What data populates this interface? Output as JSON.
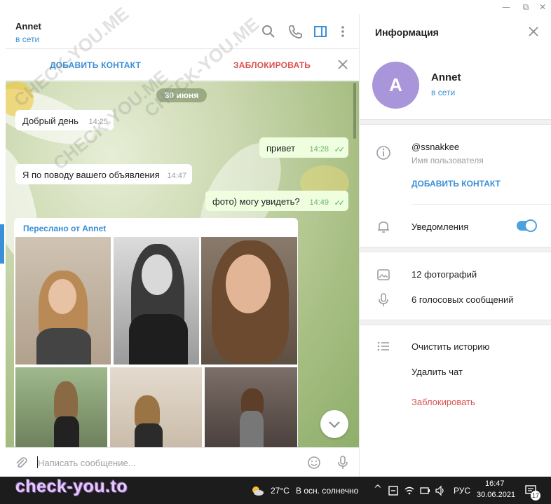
{
  "window": {
    "minimize": "—",
    "maximize": "⧉",
    "close": "✕"
  },
  "chat_header": {
    "name": "Annet",
    "status": "в сети",
    "icons": [
      "search-icon",
      "phone-icon",
      "sidebar-toggle-icon",
      "more-vertical-icon"
    ]
  },
  "action_bar": {
    "add_contact": "ДОБАВИТЬ КОНТАКТ",
    "block": "ЗАБЛОКИРОВАТЬ",
    "close_icon": "close-icon"
  },
  "messages": {
    "date": "30 июня",
    "m1": {
      "text": "Добрый день",
      "time": "14:25",
      "direction": "in"
    },
    "m2": {
      "text": "привет",
      "time": "14:28",
      "direction": "out",
      "ticks": "✓✓"
    },
    "m3": {
      "text": "Я по поводу вашего объявления",
      "time": "14:47",
      "direction": "in"
    },
    "m4": {
      "text": "фото) могу увидеть?",
      "time": "14:49",
      "direction": "out",
      "ticks": "✓✓"
    },
    "album": {
      "forwarded_from": "Переслано от Annet",
      "photo_count": 6
    }
  },
  "composer": {
    "placeholder": "Написать сообщение...",
    "icons": [
      "paperclip-icon",
      "emoji-icon",
      "microphone-icon"
    ]
  },
  "info_panel": {
    "title": "Информация",
    "avatar_letter": "A",
    "avatar_color": "#a995da",
    "name": "Annet",
    "status": "в сети",
    "username": "@ssnakkee",
    "username_caption": "Имя пользователя",
    "add_contact": "ДОБАВИТЬ КОНТАКТ",
    "notifications": "Уведомления",
    "notifications_on": true,
    "photos": "12 фотографий",
    "voice": "6 голосовых сообщений",
    "clear_history": "Очистить историю",
    "delete_chat": "Удалить чат",
    "block": "Заблокировать"
  },
  "taskbar": {
    "brand": "check-you.to",
    "weather_temp": "27°C",
    "weather_text": "В осн. солнечно",
    "lang": "РУС",
    "time": "16:47",
    "date": "30.06.2021",
    "notifications_count": "17"
  },
  "watermarks": {
    "w1": "CHECK-YOU.ME",
    "w2": "CHECK-YOU.ME",
    "w3": "CHECK-YOU.ME"
  },
  "colors": {
    "accent": "#3a8fd6",
    "danger": "#d9534f",
    "outgoing_bubble": "#eefedf"
  }
}
